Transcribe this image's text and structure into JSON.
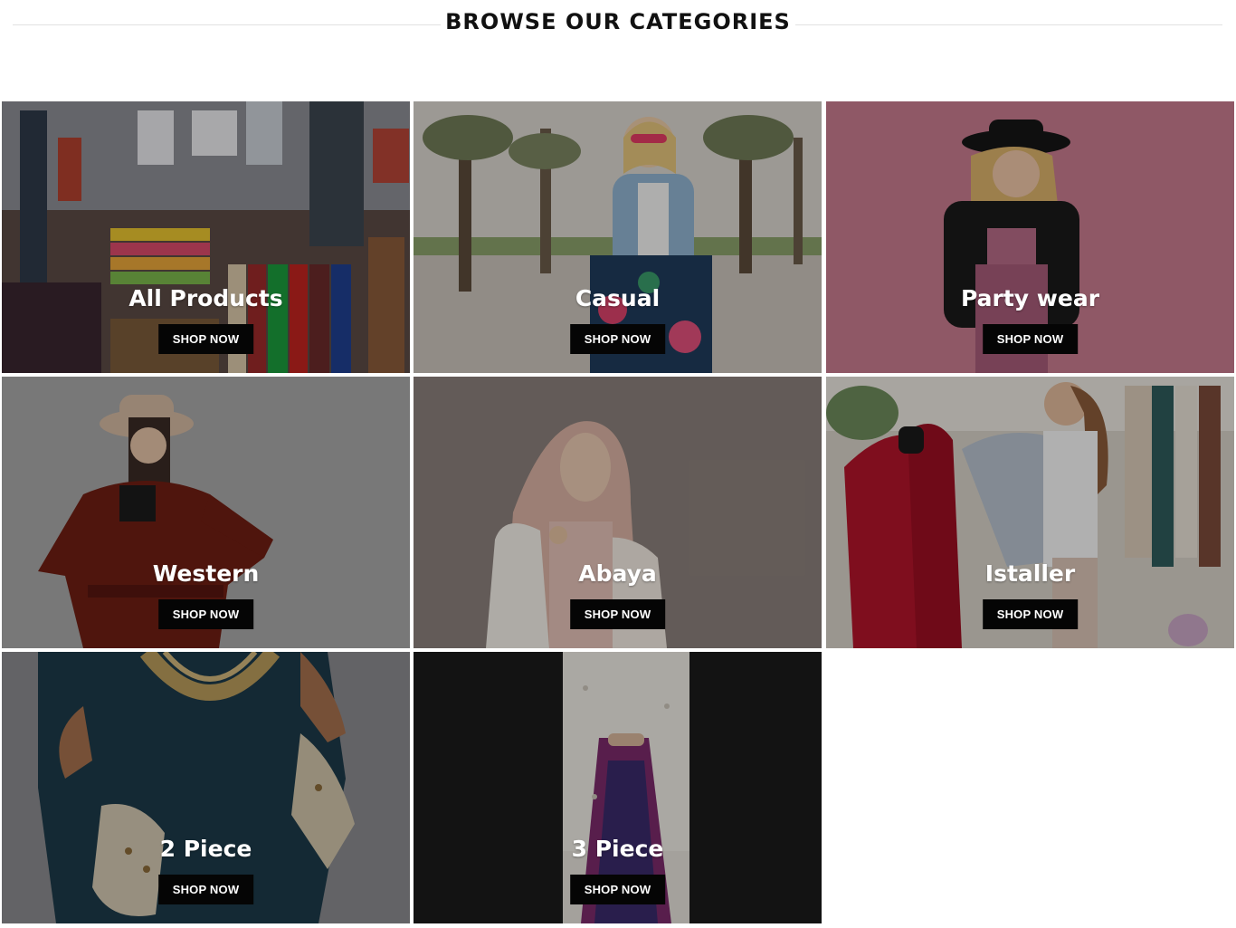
{
  "section": {
    "title": "BROWSE OUR CATEGORIES"
  },
  "categories": [
    {
      "title": "All Products",
      "button": "SHOP NOW",
      "icon": "store-racks-photo"
    },
    {
      "title": "Casual",
      "button": "SHOP NOW",
      "icon": "denim-jacket-woman-photo"
    },
    {
      "title": "Party wear",
      "button": "SHOP NOW",
      "icon": "hat-woman-pink-photo"
    },
    {
      "title": "Western",
      "button": "SHOP NOW",
      "icon": "trench-coat-woman-photo"
    },
    {
      "title": "Abaya",
      "button": "SHOP NOW",
      "icon": "hijab-woman-photo"
    },
    {
      "title": "Istaller",
      "button": "SHOP NOW",
      "icon": "tailor-mannequin-photo"
    },
    {
      "title": "2 Piece",
      "button": "SHOP NOW",
      "icon": "embroidered-kurta-photo"
    },
    {
      "title": "3 Piece",
      "button": "SHOP NOW",
      "icon": "white-kurta-dupatta-photo"
    }
  ],
  "colors": {
    "button_bg": "#050505",
    "button_text": "#ffffff",
    "title_text": "#ffffff",
    "heading_text": "#111111"
  }
}
